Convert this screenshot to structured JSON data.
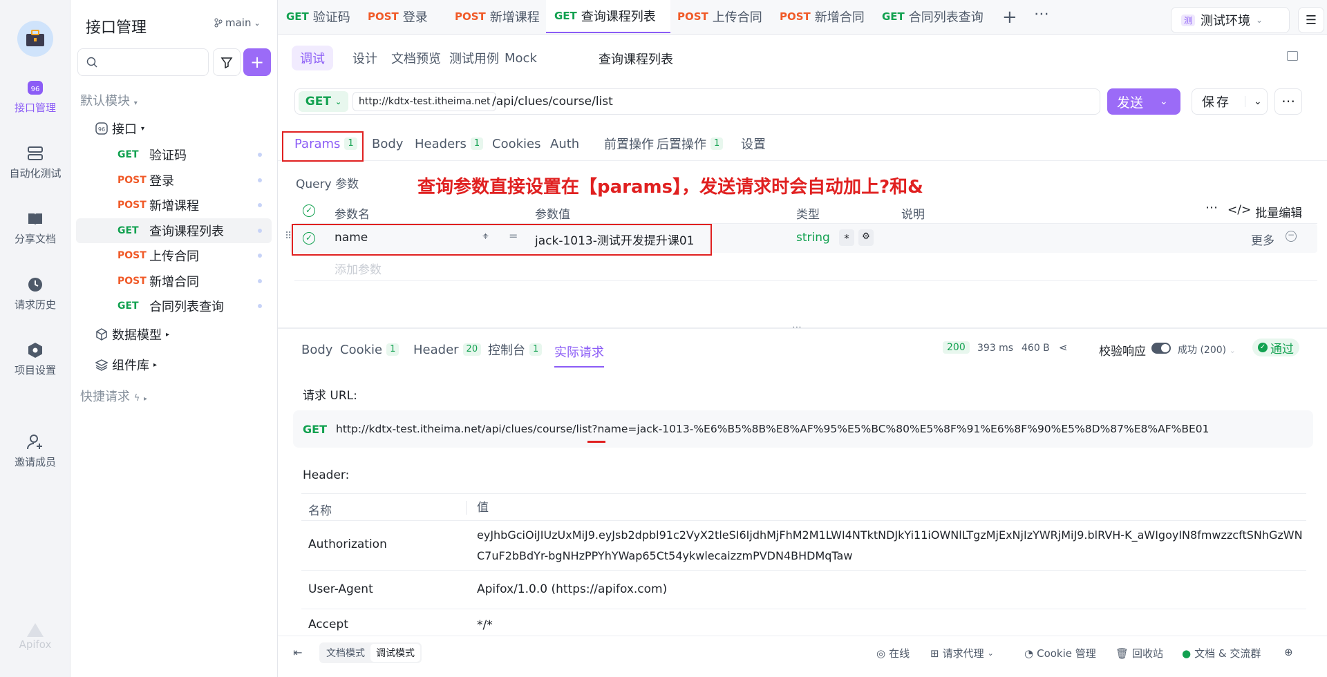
{
  "rail": {
    "items": [
      {
        "label": "接口管理",
        "icon": "api-management-icon"
      },
      {
        "label": "自动化测试",
        "icon": "automation-icon"
      },
      {
        "label": "分享文档",
        "icon": "book-icon"
      },
      {
        "label": "请求历史",
        "icon": "clock-icon"
      },
      {
        "label": "项目设置",
        "icon": "hexagon-icon"
      },
      {
        "label": "邀请成员",
        "icon": "add-user-icon"
      }
    ],
    "brand": "Apifox"
  },
  "sidebar": {
    "title": "接口管理",
    "branch": "main",
    "default_module": "默认模块",
    "folder": "接口",
    "items": [
      {
        "method": "GET",
        "name": "验证码"
      },
      {
        "method": "POST",
        "name": "登录"
      },
      {
        "method": "POST",
        "name": "新增课程"
      },
      {
        "method": "GET",
        "name": "查询课程列表"
      },
      {
        "method": "POST",
        "name": "上传合同"
      },
      {
        "method": "POST",
        "name": "新增合同"
      },
      {
        "method": "GET",
        "name": "合同列表查询"
      }
    ],
    "data_model": "数据模型",
    "components": "组件库",
    "quick_request": "快捷请求"
  },
  "tabs": [
    {
      "method": "GET",
      "name": "验证码"
    },
    {
      "method": "POST",
      "name": "登录"
    },
    {
      "method": "POST",
      "name": "新增课程"
    },
    {
      "method": "GET",
      "name": "查询课程列表"
    },
    {
      "method": "POST",
      "name": "上传合同"
    },
    {
      "method": "POST",
      "name": "新增合同"
    },
    {
      "method": "GET",
      "name": "合同列表查询"
    }
  ],
  "env": "测试环境",
  "env_badge": "测",
  "subtabs": [
    "调试",
    "设计",
    "文档预览",
    "测试用例",
    "Mock"
  ],
  "api_name": "查询课程列表",
  "request": {
    "method": "GET",
    "base_url": "http://kdtx-test.itheima.net",
    "path": "/api/clues/course/list",
    "send": "发送",
    "save": "保存"
  },
  "param_tabs": [
    {
      "label": "Params",
      "badge": "1"
    },
    {
      "label": "Body",
      "badge": ""
    },
    {
      "label": "Headers",
      "badge": "1"
    },
    {
      "label": "Cookies",
      "badge": ""
    },
    {
      "label": "Auth",
      "badge": ""
    },
    {
      "label": "前置操作",
      "badge": ""
    },
    {
      "label": "后置操作",
      "badge": "1"
    },
    {
      "label": "设置",
      "badge": ""
    }
  ],
  "query_title": "Query 参数",
  "annotation": "查询参数直接设置在【params】，发送请求时会自动加上?和&",
  "param_table": {
    "headers": [
      "参数名",
      "参数值",
      "类型",
      "说明"
    ],
    "bulk_edit": "批量编辑",
    "row": {
      "name": "name",
      "value": "jack-1013-测试开发提升课01",
      "type": "string",
      "more": "更多"
    },
    "add": "添加参数"
  },
  "response_tabs": [
    {
      "label": "Body",
      "badge": ""
    },
    {
      "label": "Cookie",
      "badge": "1"
    },
    {
      "label": "Header",
      "badge": "20"
    },
    {
      "label": "控制台",
      "badge": "1"
    },
    {
      "label": "实际请求",
      "badge": ""
    }
  ],
  "status": {
    "code": "200",
    "time": "393 ms",
    "size": "460 B",
    "validate": "校验响应",
    "success": "成功 (200)",
    "pass": "通过"
  },
  "actual": {
    "url_label": "请求 URL:",
    "method": "GET",
    "url": "http://kdtx-test.itheima.net/api/clues/course/list?name=jack-1013-%E6%B5%8B%E8%AF%95%E5%BC%80%E5%8F%91%E6%8F%90%E5%8D%87%E8%AF%BE01",
    "header_label": "Header:",
    "header_cols": [
      "名称",
      "值"
    ],
    "headers": [
      {
        "k": "Authorization",
        "v": "eyJhbGciOiJIUzUxMiJ9.eyJsb2dpbl91c2VyX2tleSI6IjdhMjFhM2M1LWI4NTktNDJkYi11iOWNlLTgzMjExNjIzYWRjMiJ9.blRVH-K_aWIgoyIN8fmwzzcftSNhGzWNC7uF2bBdYr-bgNHzPPYhYWap65Ct54ykwlecaizzmPVDN4BHDMqTaw"
      },
      {
        "k": "User-Agent",
        "v": "Apifox/1.0.0 (https://apifox.com)"
      },
      {
        "k": "Accept",
        "v": "*/*"
      }
    ]
  },
  "footer": {
    "doc_mode": "文档模式",
    "debug_mode": "调试模式",
    "online": "在线",
    "proxy": "请求代理",
    "cookie": "Cookie 管理",
    "trash": "回收站",
    "docs": "文档 & 交流群"
  },
  "colors": {
    "accent": "#8b5cf6",
    "get": "#12a150",
    "post": "#f05a28",
    "highlight": "#e02020"
  }
}
